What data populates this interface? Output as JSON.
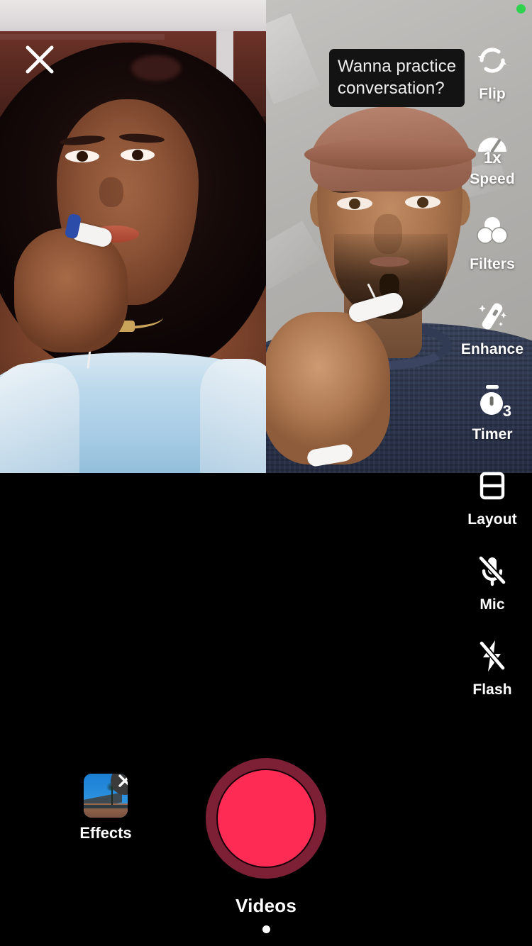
{
  "app": {
    "screen_name": "Duet camera recorder",
    "status_indicator": "camera-in-use-green-dot",
    "accent_color": "#FE2C55",
    "record_ring_color": "#7D2035",
    "background_color": "#000000"
  },
  "header": {
    "close_label": "close-icon"
  },
  "caption_overlay": {
    "text": "Wanna practice conversation?",
    "line1": "Wanna practice",
    "line2": "conversation?",
    "background_color": "#131313",
    "text_color": "#EDEDED"
  },
  "video": {
    "layout": "duet-side-by-side",
    "left_pane": {
      "name": "partner-video",
      "description": "Woman with curly hair in light blue off-shoulder top, wooden headboard background"
    },
    "right_pane": {
      "name": "self-camera-preview",
      "description": "Man in brown cap and navy knit sweater holding an earbud, light gray wall"
    }
  },
  "tool_rail": {
    "items": [
      {
        "label": "Flip",
        "icon": "flip-camera-icon",
        "state": ""
      },
      {
        "label": "Speed",
        "icon": "speed-gauge-icon",
        "state": "1x"
      },
      {
        "label": "Filters",
        "icon": "filters-icon",
        "state": ""
      },
      {
        "label": "Enhance",
        "icon": "magic-wand-icon",
        "state": ""
      },
      {
        "label": "Timer",
        "icon": "timer-icon",
        "state": "3"
      },
      {
        "label": "Layout",
        "icon": "layout-icon",
        "state": ""
      },
      {
        "label": "Mic",
        "icon": "mic-off-icon",
        "state": "off"
      },
      {
        "label": "Flash",
        "icon": "flash-off-icon",
        "state": "off"
      }
    ]
  },
  "bottom": {
    "effects": {
      "label": "Effects",
      "thumbnail": "effect-thumbnail-sky-building",
      "remove_badge": "remove-effect-x-icon"
    },
    "record": {
      "label": "record-button",
      "state": "idle"
    },
    "mode": {
      "selected": "Videos",
      "indicator": "active-mode-dot"
    }
  }
}
